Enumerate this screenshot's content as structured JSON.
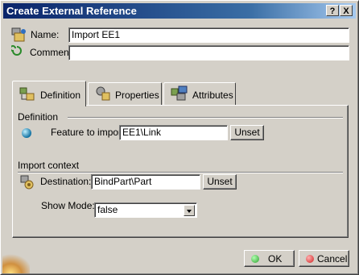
{
  "window": {
    "title": "Create External Reference"
  },
  "titlebar_buttons": {
    "help": "?",
    "close": "X"
  },
  "header": {
    "name_label": "Name:",
    "name_value": "Import EE1",
    "comment_label": "Comment:",
    "comment_value": ""
  },
  "tabs": [
    {
      "label": "Definition",
      "icon": "definition-icon",
      "active": true
    },
    {
      "label": "Properties",
      "icon": "properties-icon",
      "active": false
    },
    {
      "label": "Attributes",
      "icon": "attributes-icon",
      "active": false
    }
  ],
  "definition": {
    "group_title": "Definition",
    "feature_label": "Feature to import:",
    "feature_value": "EE1\\Link",
    "unset_label": "Unset"
  },
  "import_context": {
    "group_title": "Import context",
    "destination_label": "Destination:",
    "destination_value": "BindPart\\Part",
    "unset_label": "Unset",
    "show_mode_label": "Show Mode:",
    "show_mode_value": "false"
  },
  "footer": {
    "ok_label": "OK",
    "cancel_label": "Cancel"
  },
  "colors": {
    "titlebar_start": "#0a246a",
    "titlebar_end": "#a6caf0",
    "ok_icon": "#2ea02e",
    "cancel_icon": "#d02020"
  }
}
